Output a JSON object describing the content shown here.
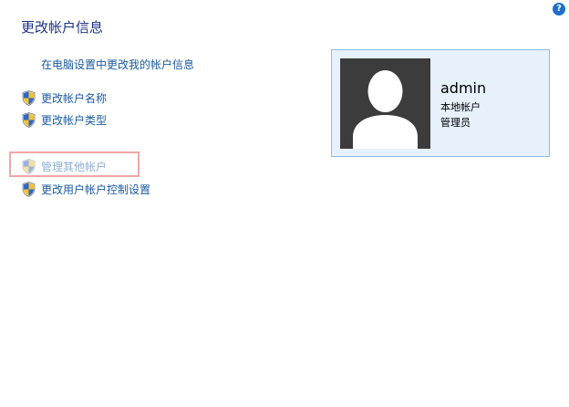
{
  "header": {
    "help_label": "?"
  },
  "page": {
    "title": "更改帐户信息",
    "pc_settings_link": "在电脑设置中更改我的帐户信息"
  },
  "tasks": [
    {
      "label": "更改帐户名称",
      "icon": "uac-shield-icon",
      "disabled": false
    },
    {
      "label": "更改帐户类型",
      "icon": "uac-shield-icon",
      "disabled": false
    },
    {
      "label": "管理其他帐户",
      "icon": "uac-shield-icon",
      "disabled": true
    },
    {
      "label": "更改用户帐户控制设置",
      "icon": "uac-shield-icon",
      "disabled": false
    }
  ],
  "account": {
    "name": "admin",
    "type": "本地帐户",
    "role": "管理员",
    "avatar_icon": "default-user-avatar-icon"
  },
  "colors": {
    "title": "#1e3287",
    "link": "#1c5aa6",
    "card_bg": "#e6f1fb",
    "card_border": "#8dbde6",
    "highlight": "#f2a7a5",
    "avatar_bg": "#3c3c3c"
  }
}
